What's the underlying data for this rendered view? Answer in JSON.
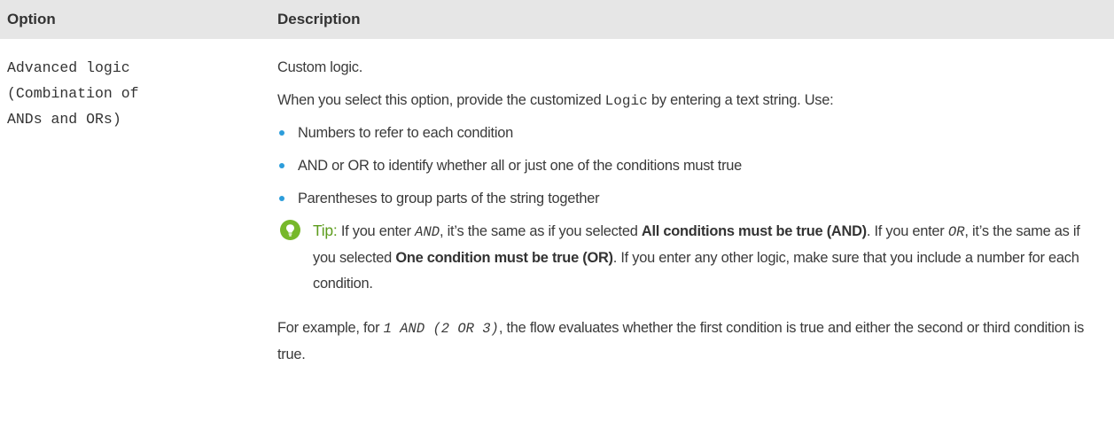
{
  "table": {
    "headers": {
      "option": "Option",
      "description": "Description"
    },
    "row": {
      "option_lines": [
        "Advanced logic",
        "(Combination of",
        "ANDs and ORs)"
      ],
      "desc": {
        "custom": "Custom logic.",
        "when_before": "When you select this option, provide the customized ",
        "when_code": "Logic",
        "when_after": " by entering a text string. Use:",
        "bullets": [
          "Numbers to refer to each condition",
          "AND or OR to identify whether all or just one of the conditions must true",
          "Parentheses to group parts of the string together"
        ],
        "tip": {
          "label": "Tip:",
          "t1": " If you enter ",
          "c1": "AND",
          "t2": ", it’s the same as if you selected ",
          "b1": "All conditions must be true (AND)",
          "t3": ". If you enter ",
          "c2": "OR",
          "t4": ", it’s the same as if you selected ",
          "b2": "One condition must be true (OR)",
          "t5": ". If you enter any other logic, make sure that you include a number for each condition."
        },
        "example": {
          "before": "For example, for ",
          "code": "1 AND (2 OR 3)",
          "after": ", the flow evaluates whether the first condition is true and either the second or third condition is true."
        }
      }
    }
  },
  "colors": {
    "header_bg": "#e6e6e6",
    "bullet": "#2c9ddb",
    "tip_icon": "#77b82a",
    "tip_label": "#5d9c1d"
  },
  "icons": {
    "tip": "lightbulb-icon",
    "bullet": "bullet-dot-icon"
  }
}
